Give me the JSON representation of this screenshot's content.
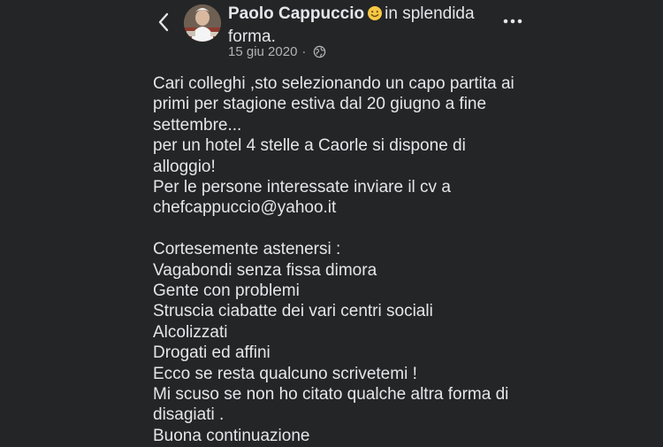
{
  "post": {
    "author": "Paolo Cappuccio",
    "feeling": "in splendida",
    "feeling_cont": "forma.",
    "date": "15 giu 2020",
    "separator": "·",
    "icons": {
      "back": "chevron-left-icon",
      "privacy": "globe-icon",
      "more": "more-horizontal-icon",
      "emoji": "smiling-face-emoji"
    },
    "body": {
      "l1": "Cari colleghi ,sto selezionando un capo partita ai",
      "l2": "primi per stagione estiva dal 20 giugno a fine",
      "l3": "settembre...",
      "l4": "per un hotel 4 stelle a Caorle si dispone di",
      "l5": "alloggio!",
      "l6": "Per le persone interessate inviare il cv a",
      "l7": "chefcappuccio@yahoo.it",
      "l8": "Cortesemente astenersi :",
      "l9": "Vagabondi senza fissa dimora",
      "l10": "Gente con problemi",
      "l11": "Struscia ciabatte dei vari centri sociali",
      "l12": "Alcolizzati",
      "l13": "Drogati ed affini",
      "l14": "Ecco se resta qualcuno scrivetemi !",
      "l15": "Mi scuso se non ho citato qualche altra forma di",
      "l16": "disagiati .",
      "l17": "Buona continuazione"
    }
  },
  "colors": {
    "background": "#242526",
    "text_primary": "#e4e6eb",
    "text_secondary": "#b0b3b8"
  }
}
